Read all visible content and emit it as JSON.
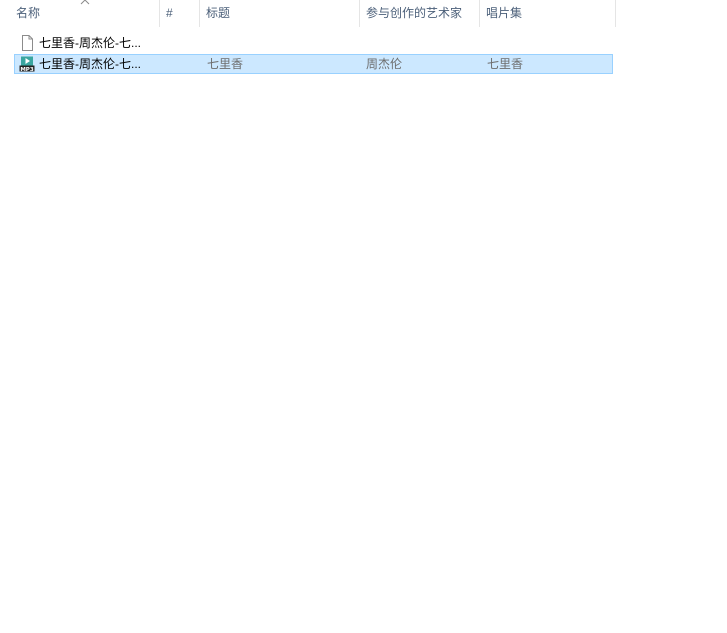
{
  "columns": {
    "name": "名称",
    "number": "#",
    "title": "标题",
    "artists": "参与创作的艺术家",
    "album": "唱片集"
  },
  "sort": {
    "column": "name",
    "icon": "chevron-up-icon"
  },
  "files": [
    {
      "name": "七里香-周杰伦-七...",
      "icon": "document-icon",
      "number": "",
      "title": "",
      "artists": "",
      "album": "",
      "selected": false
    },
    {
      "name": "七里香-周杰伦-七...",
      "icon": "mp3-file-icon",
      "number": "",
      "title": "七里香",
      "artists": "周杰伦",
      "album": "七里香",
      "selected": true
    }
  ],
  "colors": {
    "selection_bg": "#cce8ff",
    "selection_border": "#99d1ff",
    "header_text": "#4c607a",
    "mp3_icon": "#3aa6a0"
  }
}
